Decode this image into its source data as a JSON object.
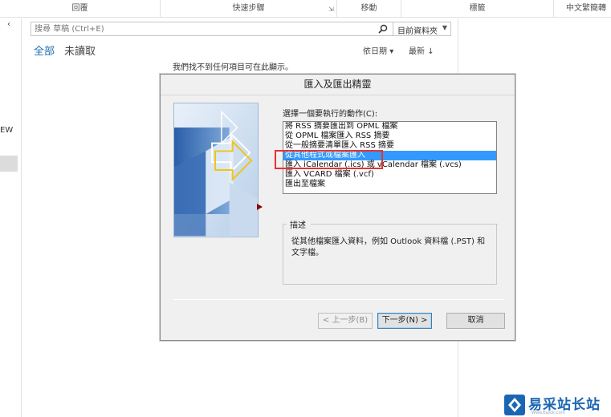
{
  "ribbon": {
    "groups": [
      "回覆",
      "快速步驟",
      "移動",
      "標籤",
      "中文繁簡轉"
    ]
  },
  "left_pane": {
    "fragment_text": "EW"
  },
  "search": {
    "placeholder": "搜尋 草稿 (Ctrl+E)",
    "scope": "目前資料夾"
  },
  "filters": {
    "all": "全部",
    "unread": "未讀取",
    "sort_by": "依日期",
    "order": "最新"
  },
  "message_list": {
    "empty_text": "我們找不到任何項目可在此顯示。"
  },
  "dialog": {
    "title": "匯入及匯出精靈",
    "action_label": "選擇一個要執行的動作(C):",
    "actions": [
      "將 RSS 摘要匯出到 OPML 檔案",
      "從 OPML 檔案匯入 RSS 摘要",
      "從一般摘要清單匯入 RSS 摘要",
      "從其他程式或檔案匯入",
      "匯入 iCalendar (.ics) 或 vCalendar 檔案 (.vcs)",
      "匯入 VCARD 檔案 (.vcf)",
      "匯出至檔案"
    ],
    "selected_index": 3,
    "description_label": "描述",
    "description_text": "從其他檔案匯入資料，例如 Outlook 資料檔 (.PST) 和文字檔。",
    "buttons": {
      "back": "< 上一步(B)",
      "next": "下一步(N) >",
      "cancel": "取消"
    }
  },
  "watermark": {
    "text": "易采站长站",
    "sub": "Www.Easck.Com"
  },
  "colors": {
    "accent": "#1f6fb5",
    "selection": "#3399ff",
    "highlight": "#e8322f"
  }
}
